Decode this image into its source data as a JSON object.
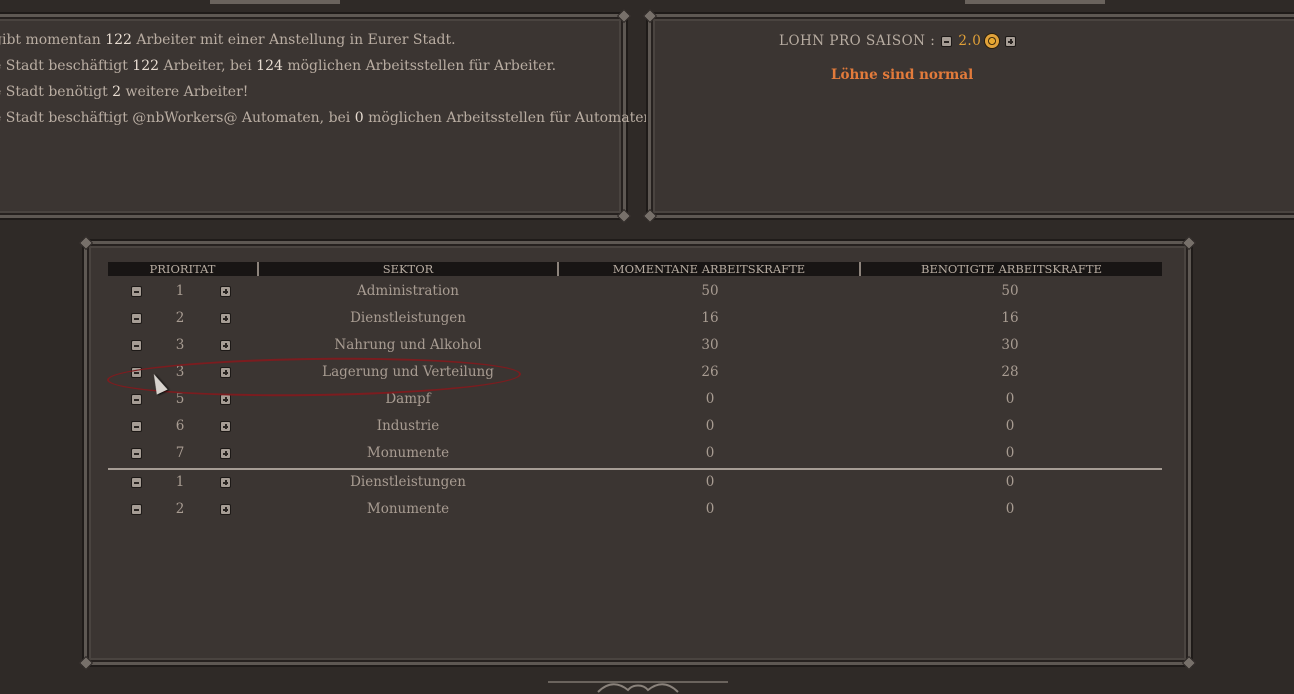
{
  "info": {
    "line1_pre": "gibt momentan ",
    "line1_num": "122",
    "line1_post": " Arbeiter mit einer Anstellung in Eurer Stadt.",
    "line2_pre": "e Stadt beschäftigt ",
    "line2_num1": "122",
    "line2_mid": " Arbeiter, bei ",
    "line2_num2": "124",
    "line2_post": " möglichen Arbeitsstellen für Arbeiter.",
    "line3_pre": "e Stadt benötigt ",
    "line3_num": "2",
    "line3_post": " weitere Arbeiter!",
    "line4_pre": "e Stadt beschäftigt @nbWorkers@ Automaten, bei ",
    "line4_num": "0",
    "line4_post": " möglichen Arbeitsstellen für Automaten."
  },
  "wage": {
    "label": "LOHN PRO SAISON :",
    "value": "2.0",
    "status": "Löhne sind normal"
  },
  "table": {
    "headers": {
      "priority": "PRIORITAT",
      "sector": "SEKTOR",
      "current": "MOMENTANE ARBEITSKRAFTE",
      "needed": "BENOTIGTE ARBEITSKRAFTE"
    },
    "rows": [
      {
        "priority": "1",
        "sector": "Administration",
        "current": "50",
        "needed": "50"
      },
      {
        "priority": "2",
        "sector": "Dienstleistungen",
        "current": "16",
        "needed": "16"
      },
      {
        "priority": "3",
        "sector": "Nahrung und Alkohol",
        "current": "30",
        "needed": "30"
      },
      {
        "priority": "3",
        "sector": "Lagerung und Verteilung",
        "current": "26",
        "needed": "28"
      },
      {
        "priority": "5",
        "sector": "Dampf",
        "current": "0",
        "needed": "0"
      },
      {
        "priority": "6",
        "sector": "Industrie",
        "current": "0",
        "needed": "0"
      },
      {
        "priority": "7",
        "sector": "Monumente",
        "current": "0",
        "needed": "0"
      }
    ],
    "automaton_rows": [
      {
        "priority": "1",
        "sector": "Dienstleistungen",
        "current": "0",
        "needed": "0"
      },
      {
        "priority": "2",
        "sector": "Monumente",
        "current": "0",
        "needed": "0"
      }
    ]
  },
  "colors": {
    "background": "#2f2a27",
    "panel": "#3b3532",
    "wage_value": "#e0a038",
    "wage_status": "#e37b3b",
    "highlight": "#7c1c1f"
  }
}
